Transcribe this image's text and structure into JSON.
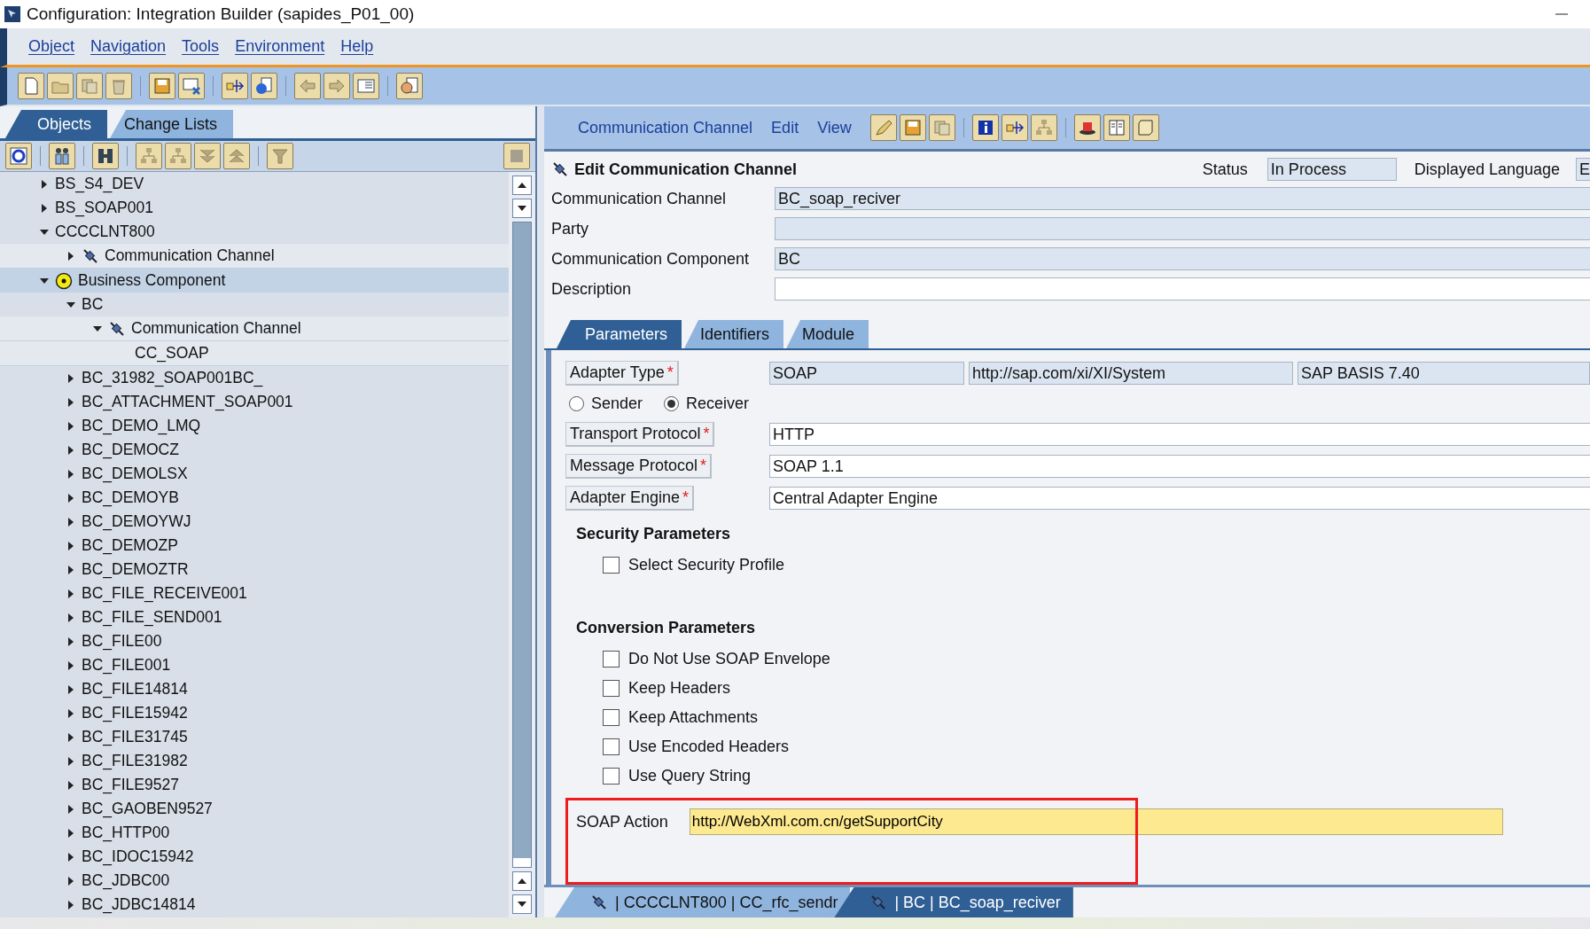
{
  "window": {
    "title": "Configuration: Integration Builder (sapides_P01_00)"
  },
  "menu": [
    {
      "label": "Object"
    },
    {
      "label": "Navigation"
    },
    {
      "label": "Tools"
    },
    {
      "label": "Environment"
    },
    {
      "label": "Help"
    }
  ],
  "left_tabs": [
    {
      "label": "Objects",
      "selected": true
    },
    {
      "label": "Change Lists",
      "selected": false
    }
  ],
  "tree": [
    {
      "children": [
        {
          "label": "BS_S4_DEV",
          "expanded": false,
          "selected": false
        },
        {
          "label": "BS_SOAP001",
          "expanded": false,
          "selected": false
        },
        {
          "label": "CCCCLNT800",
          "expanded": true,
          "selected": false,
          "children": [
            {
              "label": "Communication Channel",
              "kind": "channel",
              "expanded": false,
              "selected": false
            }
          ]
        }
      ]
    },
    {
      "label": "Business Component",
      "kind": "component",
      "expanded": true,
      "selected": true,
      "children": [
        {
          "label": "BC",
          "expanded": true,
          "selected": false,
          "children": [
            {
              "label": "Communication Channel",
              "kind": "channel",
              "expanded": true,
              "selected": false,
              "children": [
                {
                  "label": "CC_SOAP",
                  "kind": "leaf",
                  "selected": false
                }
              ]
            }
          ]
        },
        {
          "label": "BC_31982_SOAP001BC_",
          "expanded": false,
          "selected": false
        },
        {
          "label": "BC_ATTACHMENT_SOAP001",
          "expanded": false,
          "selected": false
        },
        {
          "label": "BC_DEMO_LMQ",
          "expanded": false,
          "selected": false
        },
        {
          "label": "BC_DEMOCZ",
          "expanded": false,
          "selected": false
        },
        {
          "label": "BC_DEMOLSX",
          "expanded": false,
          "selected": false
        },
        {
          "label": "BC_DEMOYB",
          "expanded": false,
          "selected": false
        },
        {
          "label": "BC_DEMOYWJ",
          "expanded": false,
          "selected": false
        },
        {
          "label": "BC_DEMOZP",
          "expanded": false,
          "selected": false
        },
        {
          "label": "BC_DEMOZTR",
          "expanded": false,
          "selected": false
        },
        {
          "label": "BC_FILE_RECEIVE001",
          "expanded": false,
          "selected": false
        },
        {
          "label": "BC_FILE_SEND001",
          "expanded": false,
          "selected": false
        },
        {
          "label": "BC_FILE00",
          "expanded": false,
          "selected": false
        },
        {
          "label": "BC_FILE001",
          "expanded": false,
          "selected": false
        },
        {
          "label": "BC_FILE14814",
          "expanded": false,
          "selected": false
        },
        {
          "label": "BC_FILE15942",
          "expanded": false,
          "selected": false
        },
        {
          "label": "BC_FILE31745",
          "expanded": false,
          "selected": false
        },
        {
          "label": "BC_FILE31982",
          "expanded": false,
          "selected": false
        },
        {
          "label": "BC_FILE9527",
          "expanded": false,
          "selected": false
        },
        {
          "label": "BC_GAOBEN9527",
          "expanded": false,
          "selected": false
        },
        {
          "label": "BC_HTTP00",
          "expanded": false,
          "selected": false
        },
        {
          "label": "BC_IDOC15942",
          "expanded": false,
          "selected": false
        },
        {
          "label": "BC_JDBC00",
          "expanded": false,
          "selected": false
        },
        {
          "label": "BC_JDBC14814",
          "expanded": false,
          "selected": false
        }
      ]
    }
  ],
  "editor_menu": [
    {
      "label": "Communication Channel"
    },
    {
      "label": "Edit"
    },
    {
      "label": "View"
    }
  ],
  "editor": {
    "title": "Edit Communication Channel",
    "status_label": "Status",
    "status": "In Process",
    "language_label": "Displayed Language",
    "language": "E",
    "fields": [
      {
        "label": "Communication Channel",
        "value": "BC_soap_reciver",
        "readonly": true
      },
      {
        "label": "Party",
        "readonly": true
      },
      {
        "label": "Communication Component",
        "value": "BC",
        "readonly": true
      },
      {
        "label": "Description",
        "readonly": false
      }
    ]
  },
  "tabs": [
    {
      "label": "Parameters",
      "selected": true
    },
    {
      "label": "Identifiers",
      "selected": false
    },
    {
      "label": "Module",
      "selected": false
    }
  ],
  "parameters": {
    "adapter_type": {
      "label": "Adapter Type",
      "required_mark": "*",
      "values": [
        "SOAP",
        "http://sap.com/xi/XI/System",
        "SAP BASIS 7.40"
      ]
    },
    "direction": [
      {
        "label": "Sender",
        "selected": false
      },
      {
        "label": "Receiver",
        "selected": true
      }
    ],
    "fields": [
      {
        "label": "Transport Protocol",
        "required_mark": "*",
        "value": "HTTP"
      },
      {
        "label": "Message Protocol",
        "required_mark": "*",
        "value": "SOAP 1.1"
      },
      {
        "label": "Adapter Engine",
        "required_mark": "*",
        "value": "Central Adapter Engine"
      }
    ],
    "sections": [
      {
        "title": "Security Parameters",
        "options": [
          {
            "label": "Select Security Profile",
            "checked": false
          }
        ]
      },
      {
        "title": "Conversion Parameters",
        "options": [
          {
            "label": "Do Not Use SOAP Envelope",
            "checked": false
          },
          {
            "label": "Keep Headers",
            "checked": false
          },
          {
            "label": "Keep Attachments",
            "checked": false
          },
          {
            "label": "Use Encoded Headers",
            "checked": false
          },
          {
            "label": "Use Query String",
            "checked": false
          }
        ]
      }
    ],
    "soap_action": {
      "label": "SOAP Action",
      "value": "http://WebXml.com.cn/getSupportCity",
      "highlighted": true
    }
  },
  "documents": [
    {
      "label": "| CCCCLNT800 | CC_rfc_sendr",
      "selected": false
    },
    {
      "label": "| BC | BC_soap_reciver",
      "selected": true
    }
  ]
}
